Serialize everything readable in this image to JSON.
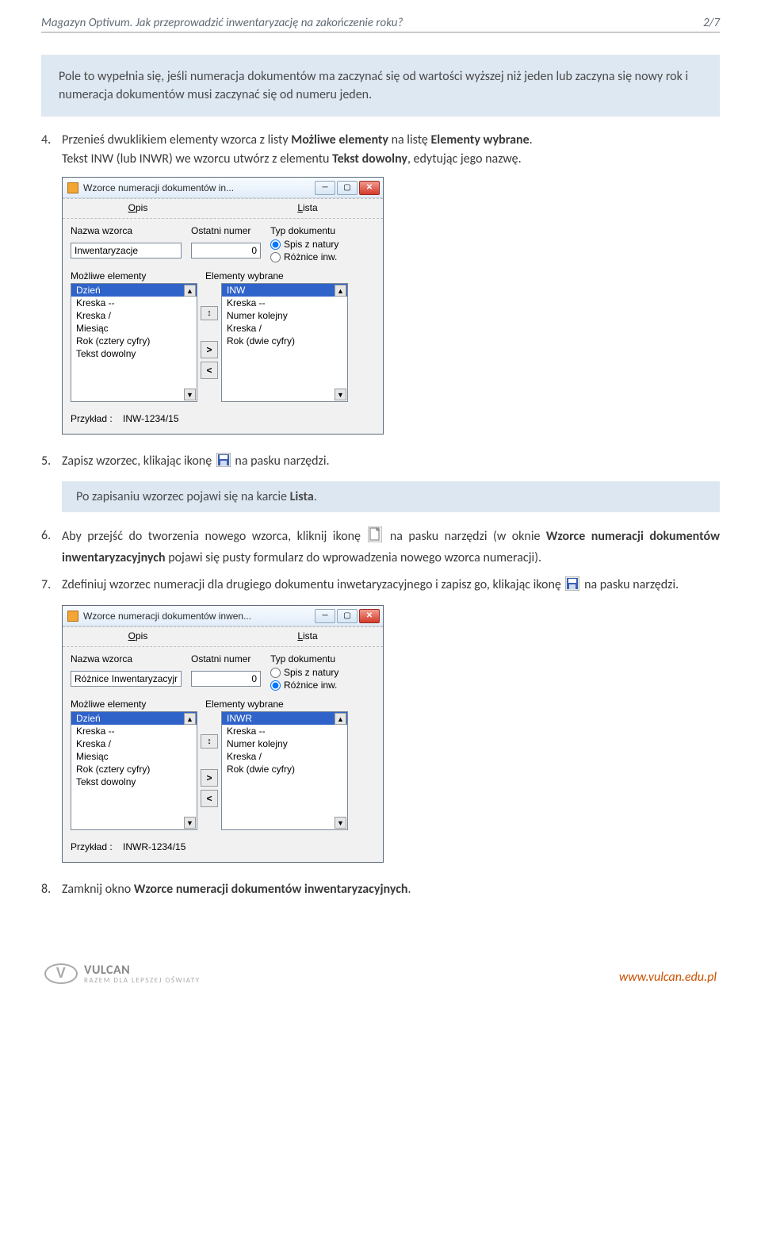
{
  "header": {
    "title": "Magazyn Optivum. Jak przeprowadzić inwentaryzację na zakończenie roku?",
    "page_indicator": "2/7"
  },
  "callout1": "Pole to wypełnia się, jeśli numeracja dokumentów ma zaczynać się od wartości wyższej niż jeden lub zaczyna się nowy rok i numeracja dokumentów musi zaczynać się od numeru jeden.",
  "steps": {
    "s4": {
      "num": "4.",
      "line1_a": "Przenieś dwuklikiem elementy wzorca z listy ",
      "line1_b": "Możliwe elementy",
      "line1_c": " na listę ",
      "line1_d": "Elementy wybrane",
      "line1_e": ".",
      "line2_a": "Tekst INW (lub INWR) we wzorcu utwórz z elementu ",
      "line2_b": "Tekst dowolny",
      "line2_c": ", edytując jego nazwę."
    },
    "s5": {
      "num": "5.",
      "text_a": "Zapisz wzorzec, klikając ikonę ",
      "text_b": "na pasku narzędzi."
    },
    "s6": {
      "num": "6.",
      "text_a": "Aby przejść do tworzenia nowego wzorca, kliknij ikonę ",
      "text_b": " na pasku narzędzi (w oknie ",
      "text_c": "Wzorce numeracji dokumentów inwentaryzacyjnych",
      "text_d": " pojawi się pusty formularz do wprowadzenia nowego wzorca numeracji)."
    },
    "s7": {
      "num": "7.",
      "text_a": "Zdefiniuj wzorzec numeracji dla drugiego dokumentu inwetaryzacyjnego i zapisz go, klikając ikonę ",
      "text_b": " na pasku narzędzi."
    },
    "s8": {
      "num": "8.",
      "text_a": "Zamknij okno ",
      "text_b": "Wzorce numeracji dokumentów inwentaryzacyjnych",
      "text_c": "."
    }
  },
  "after_save_box": {
    "text_a": "Po zapisaniu wzorzec pojawi się na karcie ",
    "text_b": "Lista",
    "text_c": "."
  },
  "dialog1": {
    "title": "Wzorce numeracji dokumentów in...",
    "menu": {
      "opis": "Opis",
      "lista": "Lista"
    },
    "labels": {
      "nazwa": "Nazwa wzorca",
      "ostatni": "Ostatni numer",
      "typ": "Typ dokumentu",
      "mozliwe": "Możliwe elementy",
      "wybrane": "Elementy wybrane",
      "przyklad": "Przykład :"
    },
    "fields": {
      "nazwa_value": "Inwentaryzacje",
      "ostatni_value": "0"
    },
    "radios": {
      "r1": "Spis z natury",
      "r2": "Różnice inw.",
      "selected": 1
    },
    "left_list": [
      "Dzień",
      "Kreska --",
      "Kreska /",
      "Miesiąc",
      "Rok (cztery cyfry)",
      "Tekst dowolny"
    ],
    "right_list": [
      "INW",
      "Kreska --",
      "Numer kolejny",
      "Kreska /",
      "Rok (dwie cyfry)"
    ],
    "example": "INW-1234/15"
  },
  "dialog2": {
    "title": "Wzorce numeracji dokumentów inwen...",
    "menu": {
      "opis": "Opis",
      "lista": "Lista"
    },
    "labels": {
      "nazwa": "Nazwa wzorca",
      "ostatni": "Ostatni numer",
      "typ": "Typ dokumentu",
      "mozliwe": "Możliwe elementy",
      "wybrane": "Elementy wybrane",
      "przyklad": "Przykład :"
    },
    "fields": {
      "nazwa_value": "Różnice Inwentaryzacyjne",
      "ostatni_value": "0"
    },
    "radios": {
      "r1": "Spis z natury",
      "r2": "Różnice inw.",
      "selected": 2
    },
    "left_list": [
      "Dzień",
      "Kreska --",
      "Kreska /",
      "Miesiąc",
      "Rok (cztery cyfry)",
      "Tekst dowolny"
    ],
    "right_list": [
      "INWR",
      "Kreska --",
      "Numer kolejny",
      "Kreska /",
      "Rok (dwie cyfry)"
    ],
    "example": "INWR-1234/15"
  },
  "footer": {
    "brand": "VULCAN",
    "tagline": "RAZEM DLA LEPSZEJ OŚWIATY",
    "website": "www.vulcan.edu.pl"
  },
  "icons": {
    "save_title": "Save",
    "new_title": "New"
  }
}
